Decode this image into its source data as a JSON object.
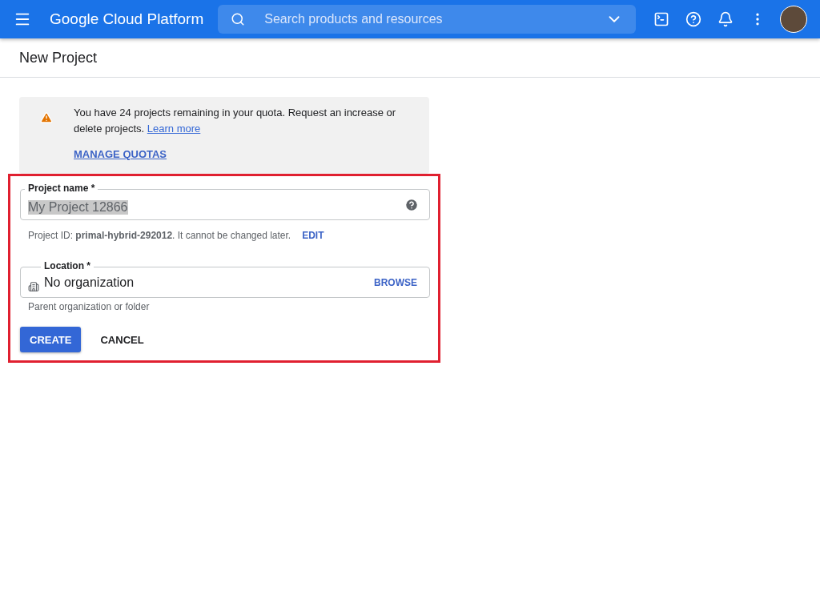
{
  "app_bar": {
    "title": "Google Cloud Platform",
    "search": {
      "placeholder": "Search products and resources"
    }
  },
  "page": {
    "title": "New Project"
  },
  "quota_notice": {
    "message": "You have 24 projects remaining in your quota. Request an increase or delete projects.",
    "link": "Learn more",
    "action": "MANAGE QUOTAS"
  },
  "form": {
    "highlighted": true,
    "project_name": {
      "label": "Project name *",
      "value": "My Project 12866",
      "value_selected": true
    },
    "project_id": {
      "text": "Project ID: **primal-hybrid-292012**. It cannot be changed later.",
      "action": "EDIT"
    },
    "location": {
      "label": "Location *",
      "value": "No organization",
      "action": "BROWSE",
      "hint": "Parent organization or folder"
    },
    "buttons": [
      {
        "label": "CREATE",
        "kind": "primary"
      },
      {
        "label": "CANCEL",
        "kind": "text"
      }
    ]
  }
}
